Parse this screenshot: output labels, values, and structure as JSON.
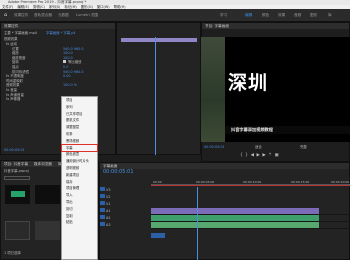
{
  "app_title": "Adobe Premiere Pro 2019 - 抖音字幕.prproj *",
  "menubar": [
    "文件(F)",
    "编辑(E)",
    "剪辑(C)",
    "序列(S)",
    "标记(M)",
    "图形(G)",
    "窗口(W)",
    "帮助(H)"
  ],
  "workspace_tabs": [
    "效果控件",
    "音轨混合器",
    "元数据",
    "Lumetri 范围",
    "学习",
    "编辑",
    "颜色",
    "效果",
    "音频",
    "图形",
    "库"
  ],
  "active_workspace": "编辑",
  "effect_controls": {
    "tab": "效果控件",
    "source": "主要 * 字幕画面.mp4",
    "sequence": "字幕画面 * 字幕.p4",
    "section_video": "视频效果",
    "rows": [
      "fx 运动",
      "位置",
      "缩放",
      "缩放宽度",
      "旋转",
      "锚点",
      "防闪烁滤镜",
      "fx 不透明度",
      "时间重映射",
      "音频效果",
      "fx 音量",
      "fx 声道音量",
      "fx 声像器"
    ],
    "values": [
      "540.0  960.0",
      "100.0",
      "100.0",
      "0.0",
      "540.0  960.0",
      "0.00",
      "100.0 %"
    ],
    "uniform_scale": "等比缩放",
    "timecode": "00:00:05:01"
  },
  "context_menu": [
    "项目",
    "序列",
    "已共享项目",
    "脱机文件",
    "调整图层",
    "彩条",
    "黑场视频",
    "字幕",
    "颜色遮罩",
    "通用倒计时片头",
    "透明视频",
    "新建项目",
    "保存",
    "项目管理",
    "导入",
    "导出",
    "剪切",
    "复制",
    "粘贴"
  ],
  "context_menu_highlighted": "字幕",
  "program_monitor": {
    "title": "节目: 字幕画面",
    "caption": "深圳",
    "subtitle": "抖音字幕添加视频教程",
    "timecode": "00:00:05:01",
    "fit": "适合",
    "quality": "完整"
  },
  "project_panel": {
    "tabs": [
      "项目: 抖音字幕",
      "媒体浏览器",
      "库"
    ],
    "file": "抖音字幕.prproj",
    "item_count": "1 项已选择"
  },
  "timeline": {
    "tab": "字幕画面",
    "timecode": "00:00:05:01",
    "ruler_labels": [
      "00:00",
      "00:00:05:00",
      "00:00:10:00",
      "00:00:15:00",
      "00:00:20:00"
    ],
    "tracks": [
      "V3",
      "V2",
      "V1",
      "A1",
      "A2",
      "A3"
    ]
  },
  "colors": {
    "accent": "#3c8fe0",
    "highlight": "#e0302a"
  }
}
